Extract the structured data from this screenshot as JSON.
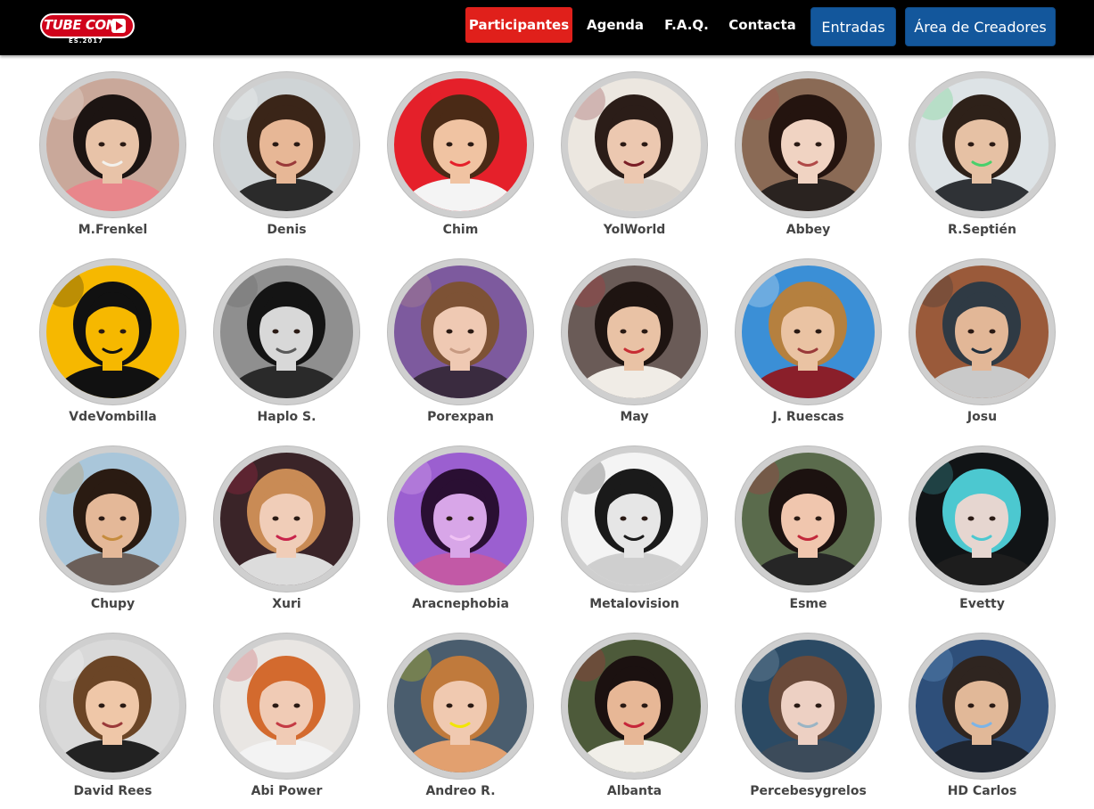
{
  "brand": {
    "logo_text": "TUBE CON",
    "logo_year": "ES.2017",
    "accent": "#e0201b",
    "button_blue": "#13579c"
  },
  "nav": {
    "items": [
      {
        "label": "Participantes",
        "active": true
      },
      {
        "label": "Agenda",
        "active": false
      },
      {
        "label": "F.A.Q.",
        "active": false
      },
      {
        "label": "Contacta",
        "active": false
      }
    ],
    "buttons": [
      {
        "label": "Entradas"
      },
      {
        "label": "Área de Creadores"
      }
    ]
  },
  "participants": [
    {
      "name": "M.Frenkel",
      "photo": {
        "bg": "#c9a89a",
        "skin": "#e8c3a8",
        "hair": "#1c1412",
        "top": "#e8868b",
        "accent": "#f3f1ec"
      }
    },
    {
      "name": "Denis",
      "photo": {
        "bg": "#cfd4d6",
        "skin": "#e7b796",
        "hair": "#3a2518",
        "top": "#2b2b2b",
        "accent": "#ffffff"
      }
    },
    {
      "name": "Chim",
      "photo": {
        "bg": "#e5202a",
        "skin": "#f0c3a2",
        "hair": "#4a2a16",
        "top": "#f4f4f4",
        "accent": "#e5202a"
      }
    },
    {
      "name": "YolWorld",
      "photo": {
        "bg": "#ece7e0",
        "skin": "#ecc8b0",
        "hair": "#2b1d18",
        "top": "#d7d2cc",
        "accent": "#7a1e26"
      }
    },
    {
      "name": "Abbey",
      "photo": {
        "bg": "#8a6a55",
        "skin": "#f0d3c2",
        "hair": "#24140f",
        "top": "#2a2320",
        "accent": "#b04a48"
      }
    },
    {
      "name": "R.Septién",
      "photo": {
        "bg": "#dde3e6",
        "skin": "#e6c1a4",
        "hair": "#2e2119",
        "top": "#2f3236",
        "accent": "#49d06b"
      }
    },
    {
      "name": "VdeVombilla",
      "photo": {
        "bg": "#f6b800",
        "skin": "#f6b800",
        "hair": "#111111",
        "top": "#111111",
        "accent": "#111111"
      }
    },
    {
      "name": "Haplo S.",
      "photo": {
        "bg": "#8f8f8f",
        "skin": "#d8d8d8",
        "hair": "#141414",
        "top": "#2a2a2a",
        "accent": "#5a5a5a"
      }
    },
    {
      "name": "Porexpan",
      "photo": {
        "bg": "#7d5a9e",
        "skin": "#efc9b3",
        "hair": "#7d5235",
        "top": "#3a2b3f",
        "accent": "#c79a82"
      }
    },
    {
      "name": "May",
      "photo": {
        "bg": "#6a5b57",
        "skin": "#e9c2a5",
        "hair": "#1e1411",
        "top": "#f0ece6",
        "accent": "#c72d34"
      }
    },
    {
      "name": "J. Ruescas",
      "photo": {
        "bg": "#3b8fd6",
        "skin": "#eac3a3",
        "hair": "#b5803f",
        "top": "#8a1f2a",
        "accent": "#ffffff"
      }
    },
    {
      "name": "Josu",
      "photo": {
        "bg": "#9a5a3a",
        "skin": "#e2b797",
        "hair": "#2f3a44",
        "top": "#c9c9c9",
        "accent": "#1f2f3d"
      }
    },
    {
      "name": "Chupy",
      "photo": {
        "bg": "#a9c6da",
        "skin": "#e4b898",
        "hair": "#2a1b12",
        "top": "#6b5f59",
        "accent": "#c68c3d"
      }
    },
    {
      "name": "Xuri",
      "photo": {
        "bg": "#3a2428",
        "skin": "#f0cdb8",
        "hair": "#c98b55",
        "top": "#dcdcdc",
        "accent": "#c8244b"
      }
    },
    {
      "name": "Aracnephobia",
      "photo": {
        "bg": "#9b5fd0",
        "skin": "#d8a6e8",
        "hair": "#2a0f33",
        "top": "#c259a6",
        "accent": "#f0c2f4"
      }
    },
    {
      "name": "Metalovision",
      "photo": {
        "bg": "#f4f4f4",
        "skin": "#e6e6e6",
        "hair": "#1a1a1a",
        "top": "#cfcfcf",
        "accent": "#1a1a1a"
      }
    },
    {
      "name": "Esme",
      "photo": {
        "bg": "#5a6b4c",
        "skin": "#f0c6ae",
        "hair": "#1c1210",
        "top": "#262626",
        "accent": "#c2283a"
      }
    },
    {
      "name": "Evetty",
      "photo": {
        "bg": "#111416",
        "skin": "#e6d6d0",
        "hair": "#4cc8d0",
        "top": "#1d1d1d",
        "accent": "#4cc8d0"
      }
    },
    {
      "name": "David Rees",
      "photo": {
        "bg": "#d9d9d9",
        "skin": "#efc7a8",
        "hair": "#6b4526",
        "top": "#222222",
        "accent": "#ffffff"
      }
    },
    {
      "name": "Abi Power",
      "photo": {
        "bg": "#e9e6e3",
        "skin": "#f0cbb5",
        "hair": "#d36a2e",
        "top": "#f3f3f3",
        "accent": "#c43b44"
      }
    },
    {
      "name": "Andreo R.",
      "photo": {
        "bg": "#4a5d6e",
        "skin": "#f0c9b0",
        "hair": "#c07a3c",
        "top": "#e2a06f",
        "accent": "#f2e600"
      }
    },
    {
      "name": "Albanta",
      "photo": {
        "bg": "#4d5a3a",
        "skin": "#e7b796",
        "hair": "#1b1110",
        "top": "#f1efe9",
        "accent": "#c6263a"
      }
    },
    {
      "name": "Percebesygrelos",
      "photo": {
        "bg": "#2b4a64",
        "skin": "#edd0c3",
        "hair": "#6a4a3a",
        "top": "#3c4b5a",
        "accent": "#9ab4c4"
      }
    },
    {
      "name": "HD Carlos",
      "photo": {
        "bg": "#2e4f7a",
        "skin": "#e1b898",
        "hair": "#2f2520",
        "top": "#1e2530",
        "accent": "#7bb4e8"
      }
    }
  ]
}
